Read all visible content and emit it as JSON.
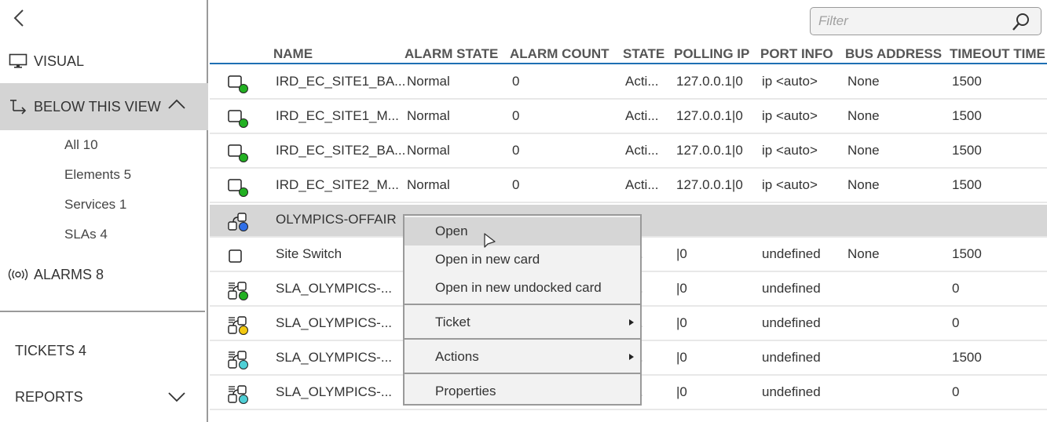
{
  "sidebar": {
    "back_label": "Back",
    "visual": "VISUAL",
    "below_this_view": "BELOW THIS VIEW",
    "sub_items": [
      {
        "label": "All 10"
      },
      {
        "label": "Elements 5"
      },
      {
        "label": "Services 1"
      },
      {
        "label": "SLAs 4"
      }
    ],
    "alarms": "ALARMS 8",
    "tickets": "TICKETS 4",
    "reports": "REPORTS"
  },
  "filter": {
    "placeholder": "Filter",
    "value": ""
  },
  "table": {
    "columns": [
      "NAME",
      "ALARM STATE",
      "ALARM COUNT",
      "STATE",
      "POLLING IP",
      "PORT INFO",
      "BUS ADDRESS",
      "TIMEOUT TIME"
    ],
    "rows": [
      {
        "icon": "element-icon",
        "status_color": "#22b022",
        "name": "IRD_EC_SITE1_BA...",
        "alarm_state": "Normal",
        "alarm_count": "0",
        "state": "Acti...",
        "polling_ip": "127.0.0.1|0",
        "port_info": "ip <auto>",
        "bus_address": "None",
        "timeout": "1500"
      },
      {
        "icon": "element-icon",
        "status_color": "#22b022",
        "name": "IRD_EC_SITE1_M...",
        "alarm_state": "Normal",
        "alarm_count": "0",
        "state": "Acti...",
        "polling_ip": "127.0.0.1|0",
        "port_info": "ip <auto>",
        "bus_address": "None",
        "timeout": "1500"
      },
      {
        "icon": "element-icon",
        "status_color": "#22b022",
        "name": "IRD_EC_SITE2_BA...",
        "alarm_state": "Normal",
        "alarm_count": "0",
        "state": "Acti...",
        "polling_ip": "127.0.0.1|0",
        "port_info": "ip <auto>",
        "bus_address": "None",
        "timeout": "1500"
      },
      {
        "icon": "element-icon",
        "status_color": "#22b022",
        "name": "IRD_EC_SITE2_M...",
        "alarm_state": "Normal",
        "alarm_count": "0",
        "state": "Acti...",
        "polling_ip": "127.0.0.1|0",
        "port_info": "ip <auto>",
        "bus_address": "None",
        "timeout": "1500"
      },
      {
        "icon": "service-icon",
        "status_color": "#2f6fe8",
        "name": "OLYMPICS-OFFAIR",
        "alarm_state": "",
        "alarm_count": "",
        "state": "",
        "polling_ip": "",
        "port_info": "",
        "bus_address": "",
        "timeout": "",
        "selected": true
      },
      {
        "icon": "element-plain-icon",
        "status_color": "",
        "name": "Site Switch",
        "alarm_state": "",
        "alarm_count": "",
        "state": "ti...",
        "polling_ip": "|0",
        "port_info": "undefined",
        "bus_address": "None",
        "timeout": "1500"
      },
      {
        "icon": "sla-icon",
        "status_color": "#22b022",
        "name": "SLA_OLYMPICS-...",
        "alarm_state": "",
        "alarm_count": "",
        "state": "ti...",
        "polling_ip": "|0",
        "port_info": "undefined",
        "bus_address": "",
        "timeout": "0"
      },
      {
        "icon": "sla-icon",
        "status_color": "#f2c811",
        "name": "SLA_OLYMPICS-...",
        "alarm_state": "",
        "alarm_count": "",
        "state": "ti...",
        "polling_ip": "|0",
        "port_info": "undefined",
        "bus_address": "",
        "timeout": "0"
      },
      {
        "icon": "sla-icon",
        "status_color": "#4fcfd6",
        "name": "SLA_OLYMPICS-...",
        "alarm_state": "",
        "alarm_count": "",
        "state": "ti...",
        "polling_ip": "|0",
        "port_info": "undefined",
        "bus_address": "",
        "timeout": "1500"
      },
      {
        "icon": "sla-icon",
        "status_color": "#4fcfd6",
        "name": "SLA_OLYMPICS-...",
        "alarm_state": "",
        "alarm_count": "",
        "state": "ti...",
        "polling_ip": "|0",
        "port_info": "undefined",
        "bus_address": "",
        "timeout": "0"
      }
    ]
  },
  "context_menu": {
    "items": [
      {
        "label": "Open",
        "hover": true,
        "submenu": false
      },
      {
        "label": "Open in new card",
        "submenu": false
      },
      {
        "label": "Open in new undocked card",
        "submenu": false
      },
      {
        "label": "Ticket",
        "submenu": true
      },
      {
        "label": "Actions",
        "submenu": true
      },
      {
        "label": "Properties",
        "submenu": false
      }
    ]
  },
  "colors": {
    "accent": "#1e6fb3",
    "selected_row": "#d6d6d6",
    "status_green": "#22b022",
    "status_blue": "#2f6fe8",
    "status_yellow": "#f2c811",
    "status_cyan": "#4fcfd6"
  }
}
